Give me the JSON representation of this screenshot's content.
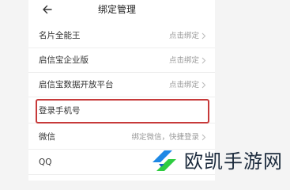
{
  "header": {
    "title": "绑定管理",
    "back_icon": "back-arrow-icon"
  },
  "rows": [
    {
      "label": "名片全能王",
      "value": "点击绑定",
      "icon": "chevron-right-icon"
    },
    {
      "label": "启信宝企业版",
      "value": "点击绑定",
      "icon": "chevron-right-icon"
    },
    {
      "label": "启信宝数据开放平台",
      "value": "点击绑定",
      "icon": "chevron-right-icon"
    },
    {
      "label": "登录手机号",
      "value": "",
      "icon": ""
    },
    {
      "label": "微信",
      "value": "绑定微信，快捷登录",
      "icon": "chevron-right-icon"
    },
    {
      "label": "QQ",
      "value": "",
      "icon": ""
    }
  ],
  "watermark": {
    "text": "欧凯手游网"
  },
  "colors": {
    "highlight": "#c73a3a",
    "logo_blue": "#1e88e5",
    "logo_green": "#2ecc40"
  }
}
